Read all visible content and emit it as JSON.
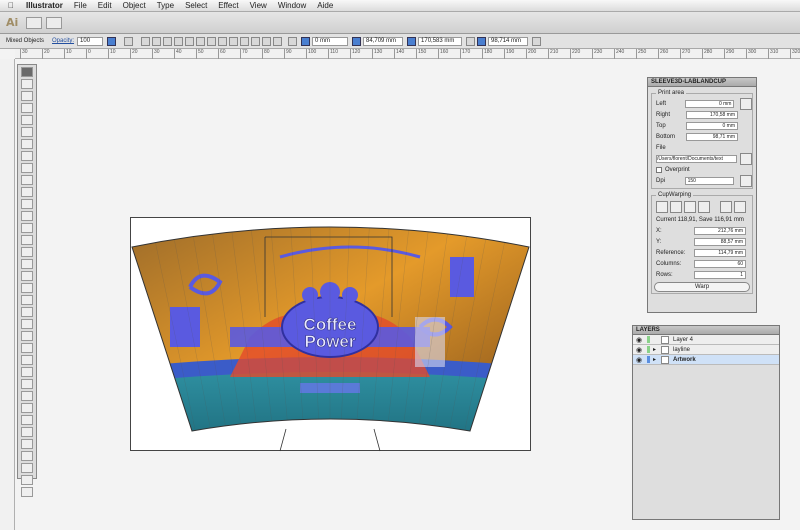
{
  "menubar": {
    "app": "Illustrator",
    "items": [
      "File",
      "Edit",
      "Object",
      "Type",
      "Select",
      "Effect",
      "View",
      "Window",
      "Aide"
    ]
  },
  "appbar": {
    "logo": "Ai"
  },
  "control": {
    "object_type": "Mixed Objects",
    "opacity_label": "Opacity:",
    "opacity_value": "100",
    "x_value": "0 mm",
    "y_value": "84,709 mm",
    "w_value": "170,583 mm",
    "h_value": "98,714 mm"
  },
  "ruler_ticks": [
    "30",
    "20",
    "10",
    "0",
    "10",
    "20",
    "30",
    "40",
    "50",
    "60",
    "70",
    "80",
    "90",
    "100",
    "110",
    "120",
    "130",
    "140",
    "150",
    "160",
    "170",
    "180",
    "190",
    "200",
    "210",
    "220",
    "230",
    "240",
    "250",
    "260",
    "270",
    "280",
    "290",
    "300",
    "310",
    "320"
  ],
  "artwork": {
    "title_line1": "Coffee",
    "title_line2": "Power"
  },
  "sleeve_panel": {
    "title": "SLEEVE3D-LABLANDCUP",
    "print_area": {
      "section": "Print area",
      "left_label": "Left",
      "left": "0 mm",
      "right_label": "Right",
      "right": "170,58 mm",
      "top_label": "Top",
      "top": "0 mm",
      "bottom_label": "Bottom",
      "bottom": "98,71 mm",
      "file_label": "File",
      "file_path": "/Users/florent/Documents/text",
      "overprint": "Overprint",
      "dpi_label": "Dpi",
      "dpi": "150"
    },
    "cupwarping": {
      "section": "CupWarping",
      "current": "Current 118,91, Save 116,91 mm",
      "x_label": "X:",
      "x": "212,76 mm",
      "y_label": "Y:",
      "y": "88,57 mm",
      "reference_label": "Reference:",
      "reference": "114,79 mm",
      "columns_label": "Columns:",
      "columns": "60",
      "rows_label": "Rows:",
      "rows": "1",
      "warp_button": "Warp"
    }
  },
  "layers_panel": {
    "title": "LAYERS",
    "layers": [
      {
        "name": "Layer 4",
        "color": "#8ad28a",
        "selected": false
      },
      {
        "name": "layline",
        "color": "#8ad28a",
        "selected": false
      },
      {
        "name": "Artwork",
        "color": "#5b8fe0",
        "selected": true
      }
    ]
  }
}
